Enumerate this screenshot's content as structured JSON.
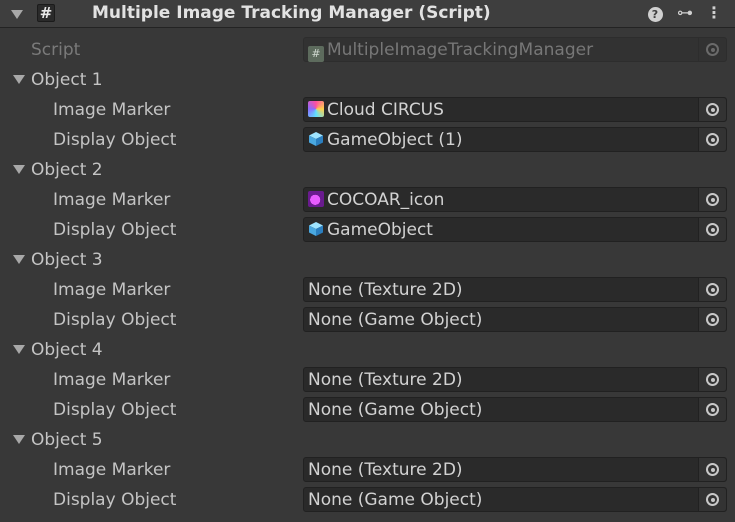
{
  "header": {
    "title": "Multiple Image Tracking Manager (Script)",
    "checkbox_glyph": "#",
    "help_glyph": "?",
    "presets_glyph": "⊶",
    "menu_glyph": "⋮"
  },
  "script_row": {
    "label": "Script",
    "value": "MultipleImageTrackingManager",
    "icon": "script-icon"
  },
  "objects": [
    {
      "label": "Object 1",
      "image_marker": {
        "label": "Image Marker",
        "value": "Cloud CIRCUS",
        "icon": "texture-icon"
      },
      "display_object": {
        "label": "Display Object",
        "value": "GameObject (1)",
        "icon": "cube-icon"
      }
    },
    {
      "label": "Object 2",
      "image_marker": {
        "label": "Image Marker",
        "value": "COCOAR_icon",
        "icon": "texture-icon"
      },
      "display_object": {
        "label": "Display Object",
        "value": "GameObject",
        "icon": "cube-icon"
      }
    },
    {
      "label": "Object 3",
      "image_marker": {
        "label": "Image Marker",
        "value": "None (Texture 2D)"
      },
      "display_object": {
        "label": "Display Object",
        "value": "None (Game Object)"
      }
    },
    {
      "label": "Object 4",
      "image_marker": {
        "label": "Image Marker",
        "value": "None (Texture 2D)"
      },
      "display_object": {
        "label": "Display Object",
        "value": "None (Game Object)"
      }
    },
    {
      "label": "Object 5",
      "image_marker": {
        "label": "Image Marker",
        "value": "None (Texture 2D)"
      },
      "display_object": {
        "label": "Display Object",
        "value": "None (Game Object)"
      }
    }
  ],
  "colors": {
    "panel_bg": "#383838",
    "field_bg": "#2a2a2a",
    "text": "#c4c4c4",
    "disabled_text": "#7a7a7a"
  }
}
